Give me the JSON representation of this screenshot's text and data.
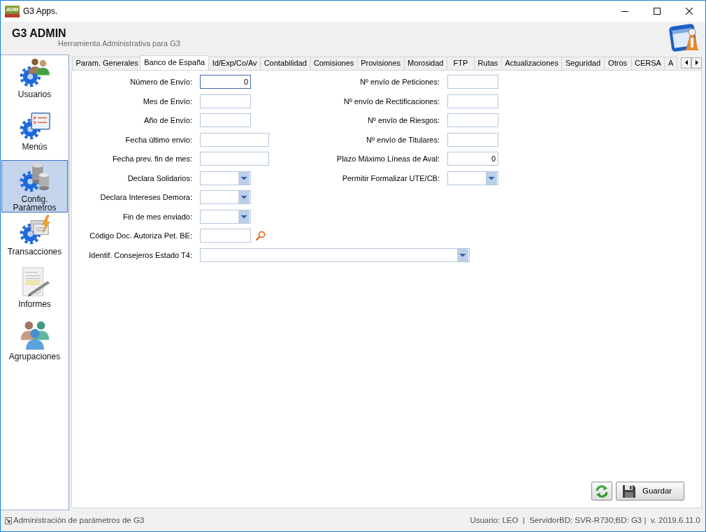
{
  "window": {
    "title": "G3 Apps.",
    "logo_text": "ADM"
  },
  "header": {
    "title": "G3 ADMIN",
    "subtitle": "Herramienta Administrativa para G3"
  },
  "sidebar": {
    "items": [
      {
        "label": "Usuarios",
        "kind": "users",
        "selected": false
      },
      {
        "label": "Menús",
        "kind": "menus",
        "selected": false
      },
      {
        "label": "Config. Parámetros",
        "kind": "parameters",
        "selected": true
      },
      {
        "label": "Transacciones",
        "kind": "transactions",
        "selected": false
      },
      {
        "label": "Informes",
        "kind": "reports",
        "selected": false
      },
      {
        "label": "Agrupaciones",
        "kind": "groups",
        "selected": false
      }
    ]
  },
  "tabs": [
    {
      "label": "Param. Generales",
      "selected": false
    },
    {
      "label": "Banco de España",
      "selected": true
    },
    {
      "label": "Id/Exp/Co/Av",
      "selected": false
    },
    {
      "label": "Contabilidad",
      "selected": false
    },
    {
      "label": "Comisiones",
      "selected": false
    },
    {
      "label": "Provisiones",
      "selected": false
    },
    {
      "label": "Morosidad",
      "selected": false
    },
    {
      "label": "FTP",
      "selected": false
    },
    {
      "label": "Rutas",
      "selected": false
    },
    {
      "label": "Actualizaciones",
      "selected": false
    },
    {
      "label": "Seguridad",
      "selected": false
    },
    {
      "label": "Otros",
      "selected": false
    },
    {
      "label": "CERSA",
      "selected": false
    },
    {
      "label": "A",
      "selected": false
    }
  ],
  "form": {
    "left_column": [
      {
        "label": "Número de Envío:",
        "kind": "short",
        "value": "0",
        "focused": true
      },
      {
        "label": "Mes de Envío:",
        "kind": "short",
        "focused": false
      },
      {
        "label": "Año de Envío:",
        "kind": "short",
        "focused": false
      },
      {
        "label": "Fecha último envio:",
        "kind": "date",
        "focused": false
      },
      {
        "label": "Fecha prev. fin de mes:",
        "kind": "date",
        "focused": false
      },
      {
        "label": "Declara Solidarios:",
        "kind": "combo",
        "focused": false
      },
      {
        "label": "Declara Intereses Demora:",
        "kind": "combo",
        "focused": false
      },
      {
        "label": "Fin de mes enviado:",
        "kind": "combo",
        "focused": false
      },
      {
        "label": "Código Doc. Autoriza Pet. BE:",
        "kind": "lookup",
        "focused": false
      },
      {
        "label": "Identif. Consejeros Estado T4:",
        "kind": "wide-combo",
        "focused": false
      }
    ],
    "right_column": [
      {
        "label": "Nº envío de Peticiones:",
        "kind": "short",
        "focused": false
      },
      {
        "label": "Nº envío de Rectificaciones:",
        "kind": "short",
        "focused": false
      },
      {
        "label": "Nº envío de Riesgos:",
        "kind": "short",
        "focused": false
      },
      {
        "label": "Nº envío de Titulares:",
        "kind": "short",
        "focused": false
      },
      {
        "label": "Plazo Máximo Líneas de Aval:",
        "kind": "short",
        "value": "0",
        "focused": false
      },
      {
        "label": "Permitir Formalizar UTE/CB:",
        "kind": "combo",
        "focused": false
      }
    ]
  },
  "buttons": [
    {
      "kind": "refresh"
    },
    {
      "kind": "save",
      "label": "Guardar"
    }
  ],
  "status_bar": {
    "text": "Administración de parámetros de G3",
    "info": "Usuario: LEO  |  ServidorBD: SVR-R730;BD: G3 |  v. 2019.6.11.0"
  }
}
